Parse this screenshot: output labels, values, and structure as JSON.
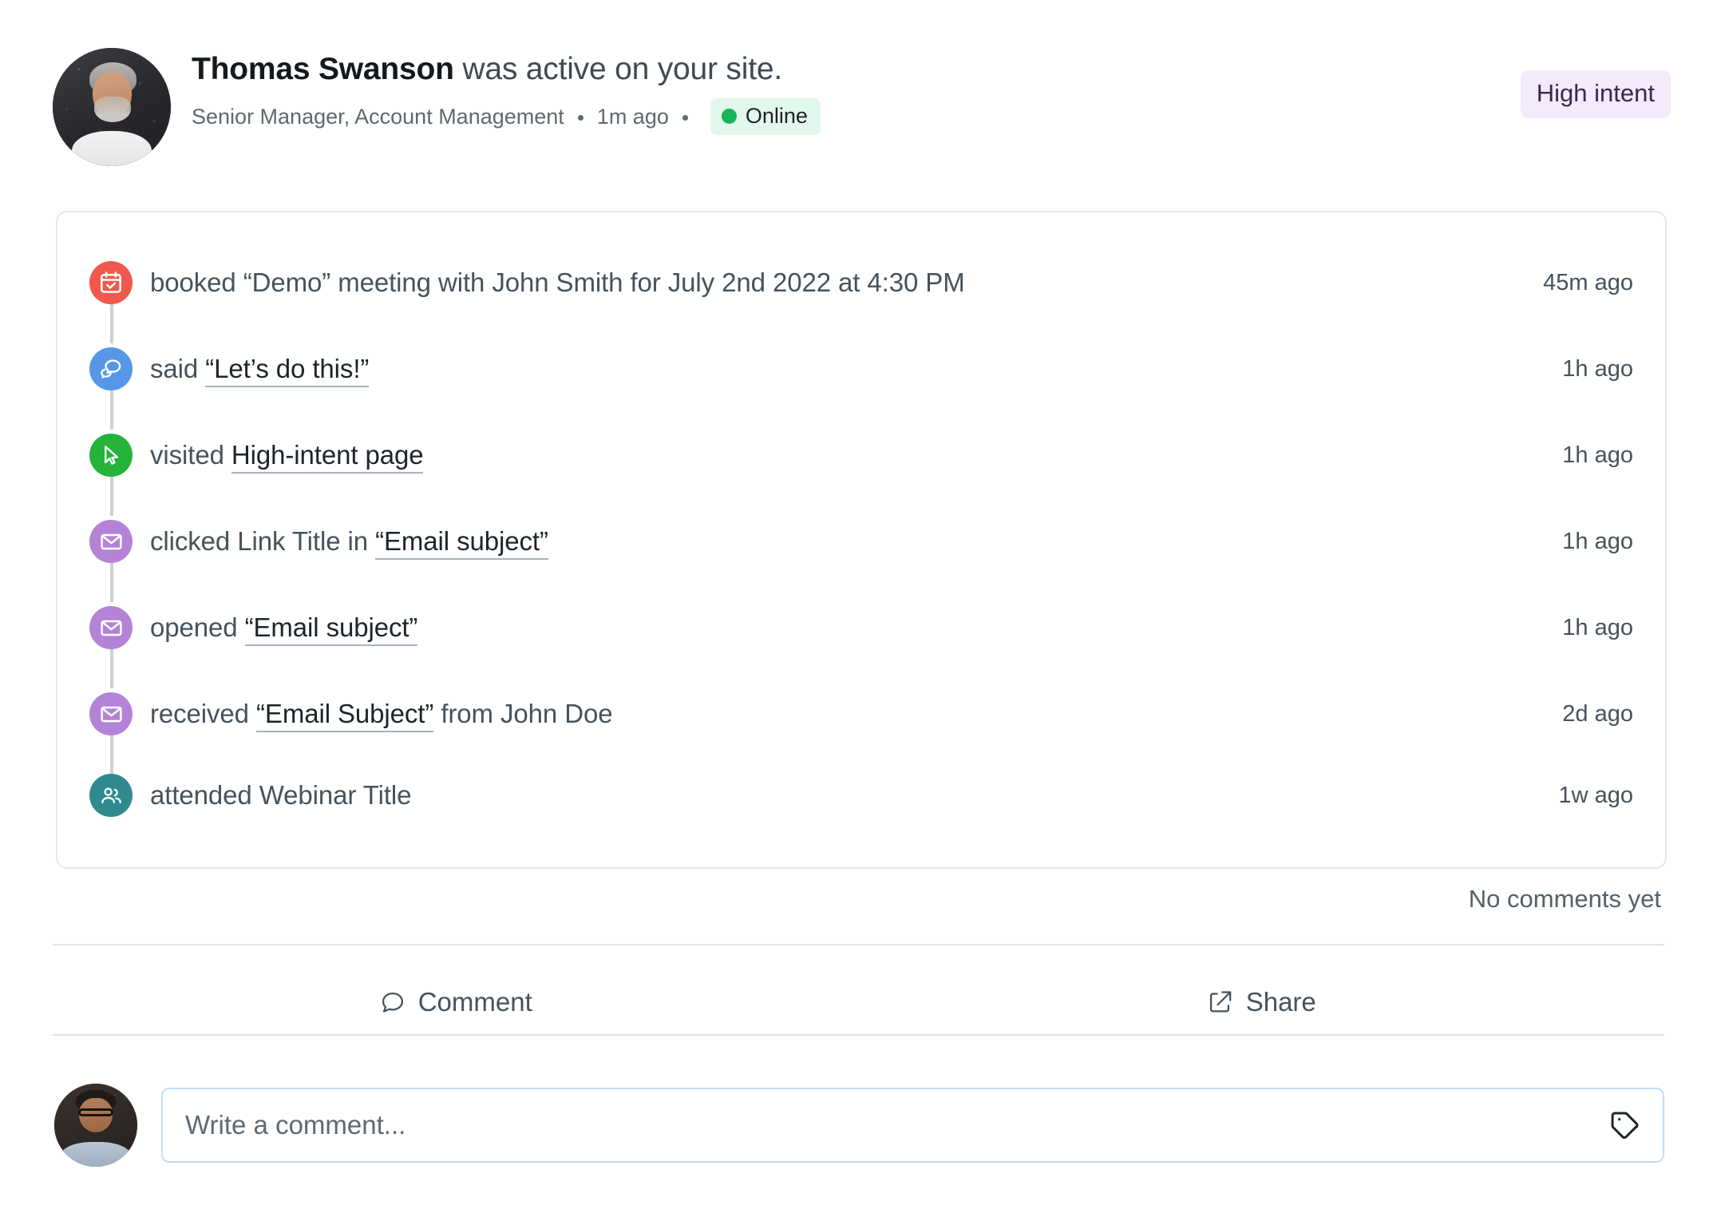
{
  "header": {
    "avatar_name": "thomas-swanson-avatar",
    "person_name": "Thomas Swanson",
    "activity_text": " was active on your site.",
    "role": "Senior Manager, Account Management",
    "time_ago": "1m ago",
    "status_label": "Online",
    "status_color": "#19b45c",
    "status_bg": "#e3f8ec",
    "intent_badge": "High intent",
    "intent_badge_bg": "#f3eafb",
    "intent_badge_color": "#3a2a48"
  },
  "timeline": {
    "events": [
      {
        "icon": "calendar-check-icon",
        "icon_color": "#f0594c",
        "prefix": "booked ",
        "link": "“Demo”",
        "link_underlined": false,
        "suffix": " meeting with John Smith for July 2nd 2022 at 4:30 PM",
        "time": "45m ago"
      },
      {
        "icon": "chat-bubbles-icon",
        "icon_color": "#5697e8",
        "prefix": "said ",
        "link": "“Let’s do this!”",
        "link_underlined": true,
        "suffix": "",
        "time": "1h ago"
      },
      {
        "icon": "cursor-pointer-icon",
        "icon_color": "#25b33a",
        "prefix": "visited ",
        "link": "High-intent page",
        "link_underlined": true,
        "suffix": "",
        "time": "1h ago"
      },
      {
        "icon": "envelope-icon",
        "icon_color": "#b483d8",
        "prefix": "clicked Link Title in ",
        "link": "“Email subject”",
        "link_underlined": true,
        "suffix": "",
        "time": "1h ago"
      },
      {
        "icon": "envelope-icon",
        "icon_color": "#b483d8",
        "prefix": "opened ",
        "link": "“Email subject”",
        "link_underlined": true,
        "suffix": "",
        "time": "1h ago"
      },
      {
        "icon": "envelope-icon",
        "icon_color": "#b483d8",
        "prefix": "received ",
        "link": "“Email Subject”",
        "link_underlined": true,
        "suffix": " from John Doe",
        "time": "2d ago"
      },
      {
        "icon": "people-group-icon",
        "icon_color": "#2e8a8f",
        "prefix": "attended Webinar Title",
        "link": "",
        "link_underlined": false,
        "suffix": "",
        "time": "1w ago"
      }
    ]
  },
  "comments": {
    "empty_state": "No comments yet",
    "comment_action": "Comment",
    "share_action": "Share",
    "input_placeholder": "Write a comment...",
    "input_value": "",
    "tag_icon": "tag-icon",
    "commenter_avatar": "current-user-avatar"
  }
}
